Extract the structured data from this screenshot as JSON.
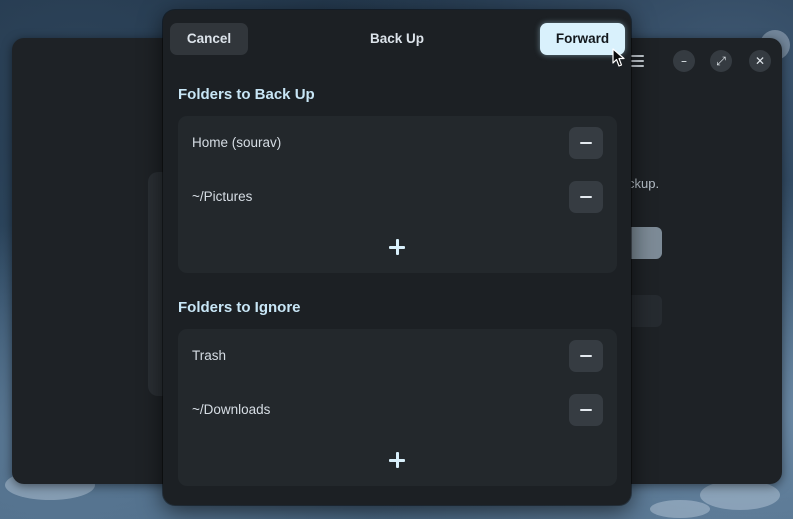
{
  "dialog": {
    "title": "Back Up",
    "cancel_label": "Cancel",
    "forward_label": "Forward"
  },
  "backup_section": {
    "title": "Folders to Back Up",
    "items": [
      {
        "label": "Home (sourav)"
      },
      {
        "label": "~/Pictures"
      }
    ]
  },
  "ignore_section": {
    "title": "Folders to Ignore",
    "items": [
      {
        "label": "Trash"
      },
      {
        "label": "~/Downloads"
      }
    ]
  },
  "background_window": {
    "partial_text": "ckup."
  },
  "icons": {
    "remove": "minus-icon",
    "add": "plus-icon",
    "menu": "hamburger-menu-icon",
    "minimize": "minimize-icon",
    "maximize": "maximize-icon",
    "close": "close-icon"
  },
  "colors": {
    "accent": "#d9f1fc",
    "section_title": "#c8e6f6",
    "dialog_bg": "#1c2024",
    "list_bg": "#23282c"
  }
}
